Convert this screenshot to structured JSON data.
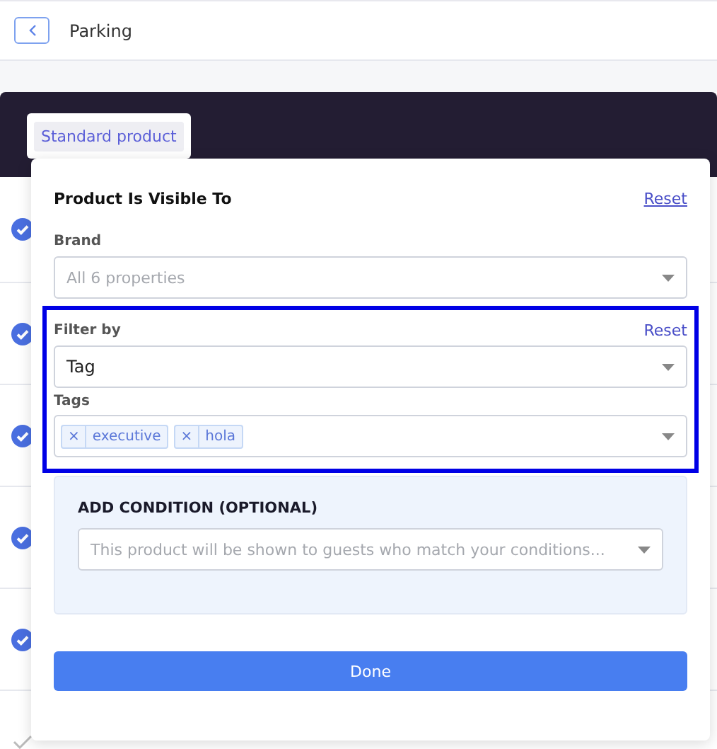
{
  "header": {
    "title": "Parking"
  },
  "product_type": "Standard product",
  "steps": [
    {
      "completed": true
    },
    {
      "completed": true
    },
    {
      "completed": true
    },
    {
      "completed": true
    },
    {
      "completed": true
    },
    {
      "completed": false
    }
  ],
  "popup": {
    "title": "Product Is Visible To",
    "reset": "Reset",
    "brand": {
      "label": "Brand",
      "placeholder": "All 6 properties"
    },
    "filter": {
      "highlighted": true,
      "label": "Filter by",
      "reset": "Reset",
      "value": "Tag",
      "tags_label": "Tags",
      "tags": [
        {
          "remove": "×",
          "label": "executive"
        },
        {
          "remove": "×",
          "label": "hola"
        }
      ]
    },
    "condition": {
      "title": "ADD CONDITION (OPTIONAL)",
      "placeholder": "This product will be shown to guests who match your conditions..."
    },
    "done": "Done"
  }
}
